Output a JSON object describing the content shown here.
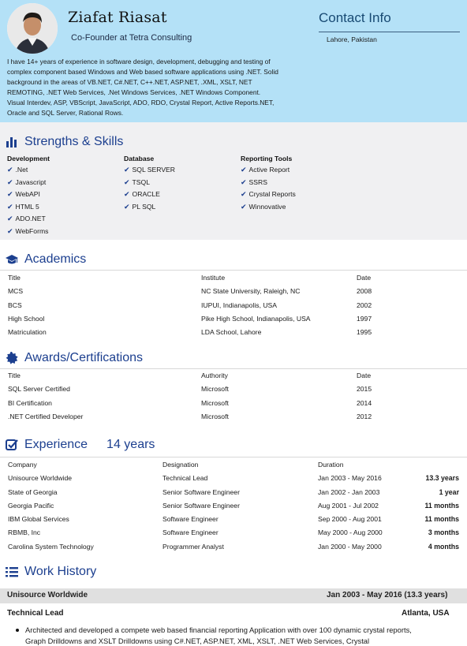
{
  "header": {
    "name": "Ziafat Riasat",
    "role": "Co-Founder at Tetra Consulting",
    "contact_title": "Contact Info",
    "location": "Lahore, Pakistan",
    "summary": "I have 14+ years of experience in software design, development, debugging and testing of complex component based Windows and Web based software applications using .NET.  Solid background in the areas of VB.NET, C#.NET, C++.NET, ASP.NET, .XML, XSLT, NET REMOTING, .NET Web Services, .Net Windows Services, .NET Windows Component. Visual Interdev, ASP, VBScript, JavaScript, ADO, RDO, Crystal Report, Active Reports.NET, Oracle and SQL Server, Rational Rows."
  },
  "skills": {
    "title": "Strengths & Skills",
    "columns": [
      {
        "header": "Development",
        "items": [
          ".Net",
          "Javascript",
          "WebAPI",
          "HTML 5",
          "ADO.NET",
          "WebForms"
        ]
      },
      {
        "header": "Database",
        "items": [
          "SQL SERVER",
          "TSQL",
          "ORACLE",
          "PL SQL"
        ]
      },
      {
        "header": "Reporting Tools",
        "items": [
          "Active Report",
          "SSRS",
          "Crystal Reports",
          "Winnovative"
        ]
      }
    ]
  },
  "academics": {
    "title": "Academics",
    "headers": [
      "Title",
      "Institute",
      "Date"
    ],
    "rows": [
      [
        "MCS",
        "NC State University, Raleigh, NC",
        "2008"
      ],
      [
        "BCS",
        "IUPUI, Indianapolis, USA",
        "2002"
      ],
      [
        "High School",
        "Pike High School, Indianapolis, USA",
        "1997"
      ],
      [
        "Matriculation",
        "LDA School, Lahore",
        "1995"
      ]
    ]
  },
  "awards": {
    "title": "Awards/Certifications",
    "headers": [
      "Title",
      "Authority",
      "Date"
    ],
    "rows": [
      [
        "SQL Server Certified",
        "Microsoft",
        "2015"
      ],
      [
        "BI Certification",
        "Microsoft",
        "2014"
      ],
      [
        ".NET Certified Developer",
        "Microsoft",
        "2012"
      ]
    ]
  },
  "experience": {
    "title": "Experience",
    "years": "14 years",
    "headers": [
      "Company",
      "Designation",
      "Duration"
    ],
    "rows": [
      [
        "Unisource Worldwide",
        "Technical Lead",
        "Jan 2003 - May 2016",
        "13.3 years"
      ],
      [
        "State of Georgia",
        "Senior Software Engineer",
        "Jan 2002 - Jan 2003",
        "1 year"
      ],
      [
        "Georgia Pacific",
        "Senior Software Engineer",
        "Aug 2001 - Jul 2002",
        "11 months"
      ],
      [
        "IBM Global Services",
        "Software Engineer",
        "Sep 2000 - Aug 2001",
        "11 months"
      ],
      [
        "RBMB, Inc",
        "Software Engineer",
        "May 2000 - Aug 2000",
        "3 months"
      ],
      [
        "Carolina System Technology",
        "Programmer Analyst",
        "Jan 2000 - May 2000",
        "4 months"
      ]
    ]
  },
  "work_history": {
    "title": "Work History",
    "company": "Unisource Worldwide",
    "period": "Jan 2003 - May 2016  (13.3 years)",
    "job_title": "Technical Lead",
    "location": "Atlanta, USA",
    "bullet": "Architected and developed a compete web based financial reporting Application with over 100 dynamic crystal reports, Graph Drilldowns and XSLT Drilldowns using C#.NET, ASP.NET, XML, XSLT, .NET Web Services, Crystal"
  },
  "colors": {
    "header_bg": "#b4e1f7",
    "accent": "#1c3f8f",
    "skills_bg": "#f0f0f2"
  },
  "icons": [
    "bar-chart-icon",
    "graduation-cap-icon",
    "award-badge-icon",
    "checkbox-icon",
    "list-icon"
  ]
}
